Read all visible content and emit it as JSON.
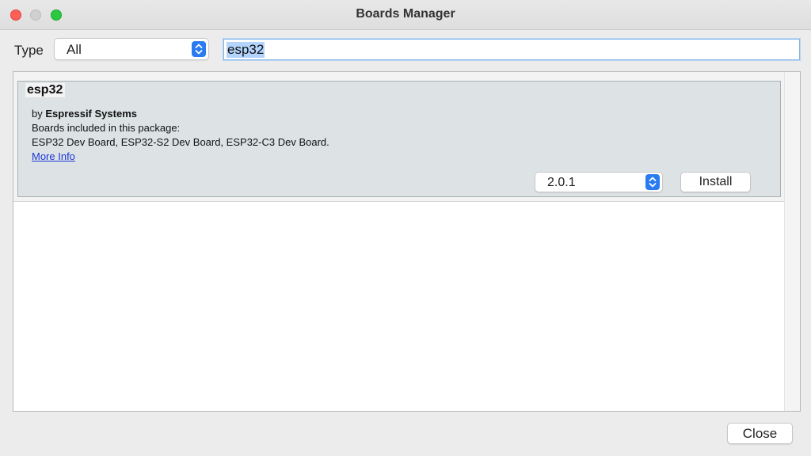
{
  "window": {
    "title": "Boards Manager"
  },
  "filter": {
    "type_label": "Type",
    "type_value": "All",
    "search_value": "esp32"
  },
  "packages": [
    {
      "name": "esp32",
      "by_prefix": "by",
      "author": "Espressif Systems",
      "boards_heading": "Boards included in this package:",
      "boards_list": "ESP32 Dev Board, ESP32-S2 Dev Board, ESP32-C3 Dev Board.",
      "more_info_label": "More Info",
      "version": "2.0.1",
      "install_label": "Install"
    }
  ],
  "footer": {
    "close_label": "Close"
  },
  "colors": {
    "accent": "#2a7bef",
    "link": "#1b34d8",
    "selection": "#b3d4fd",
    "card": "#dde3e4"
  },
  "icons": {
    "window_close": "close-traffic-light",
    "window_minimize": "minimize-traffic-light",
    "window_zoom": "zoom-traffic-light",
    "select_stepper": "up-down-chevron-icon"
  }
}
